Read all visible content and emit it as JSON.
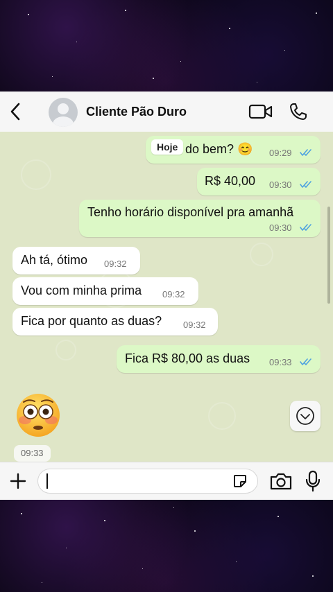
{
  "header": {
    "contact_name": "Cliente Pão Duro",
    "back_icon": "chevron-left-icon",
    "video_icon": "video-call-icon",
    "phone_icon": "phone-call-icon"
  },
  "chat": {
    "date_label": "Hoje",
    "messages": [
      {
        "direction": "out",
        "text": "do bem? 😊",
        "time": "09:29",
        "status": "read"
      },
      {
        "direction": "out",
        "text": "R$ 40,00",
        "time": "09:30",
        "status": "read"
      },
      {
        "direction": "out",
        "text": "Tenho horário disponível pra amanhã",
        "time": "09:30",
        "status": "read"
      },
      {
        "direction": "in",
        "text": "Ah tá, ótimo",
        "time": "09:32"
      },
      {
        "direction": "in",
        "text": "Vou com minha prima",
        "time": "09:32"
      },
      {
        "direction": "in",
        "text": "Fica por quanto as duas?",
        "time": "09:32"
      },
      {
        "direction": "out",
        "text": "Fica R$ 80,00 as duas",
        "time": "09:33",
        "status": "read"
      },
      {
        "direction": "in",
        "text": "😳",
        "time": "09:33",
        "type": "emoji"
      }
    ]
  },
  "composer": {
    "input_value": "",
    "plus_icon": "plus-icon",
    "sticker_icon": "sticker-icon",
    "camera_icon": "camera-icon",
    "mic_icon": "microphone-icon"
  },
  "colors": {
    "outgoing_bubble": "#dcf8c6",
    "incoming_bubble": "#ffffff",
    "chat_background": "#dfe6c7",
    "read_ticks": "#4fa3e0",
    "icon": "#111111"
  }
}
